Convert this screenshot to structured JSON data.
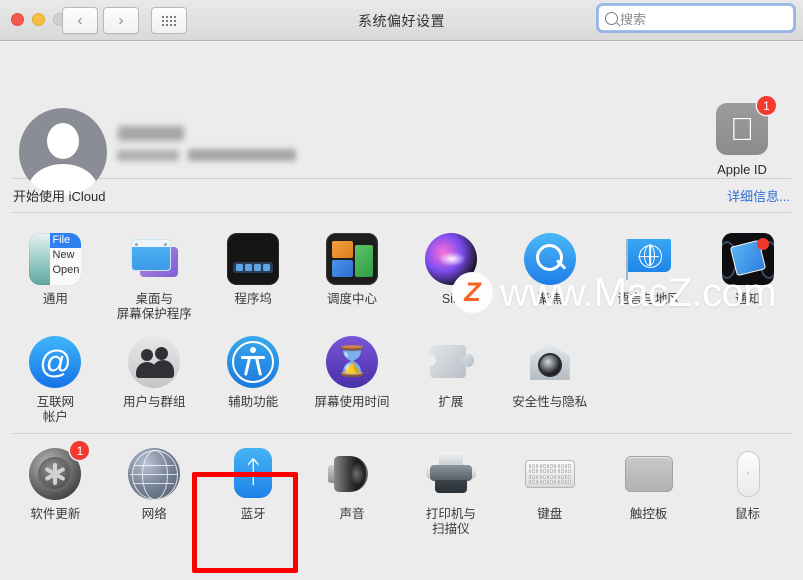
{
  "window": {
    "title": "系统偏好设置",
    "traffic_lights": [
      "close",
      "minimize",
      "zoom-disabled"
    ],
    "nav": {
      "back": "‹",
      "forward": "›",
      "grid": "grid-icon"
    },
    "search": {
      "placeholder": "搜索",
      "value": "",
      "focused": true
    }
  },
  "account": {
    "name_redacted": true,
    "detail_redacted": true,
    "apple_id": {
      "label": "Apple ID",
      "badge": "1",
      "glyph": ""
    }
  },
  "icloud": {
    "text": "开始使用 iCloud",
    "link": "详细信息..."
  },
  "watermark": {
    "logo_letter": "Z",
    "text": "www.MacZ.com"
  },
  "colors": {
    "badge_red": "#f4392f",
    "highlight_red": "#fe0000",
    "link_blue": "#2e6fd4",
    "focus_blue": "#6d9ee8",
    "bluetooth_blue": "#1d82e8",
    "watermark_orange": "#f26522"
  },
  "highlight": {
    "target": "蓝牙"
  },
  "rows": [
    {
      "items": [
        {
          "label": "通用",
          "icon": "general-icon",
          "badge": null
        },
        {
          "label": "桌面与\n屏幕保护程序",
          "icon": "desktop-screensaver-icon",
          "badge": null
        },
        {
          "label": "程序坞",
          "icon": "dock-icon",
          "badge": null
        },
        {
          "label": "调度中心",
          "icon": "mission-control-icon",
          "badge": null
        },
        {
          "label": "Siri",
          "icon": "siri-icon",
          "badge": null
        },
        {
          "label": "聚焦",
          "icon": "spotlight-icon",
          "badge": null
        },
        {
          "label": "语言与地区",
          "icon": "language-region-icon",
          "badge": null
        },
        {
          "label": "通知",
          "icon": "notifications-icon",
          "badge": null
        }
      ]
    },
    {
      "items": [
        {
          "label": "互联网\n帐户",
          "icon": "internet-accounts-icon",
          "badge": null
        },
        {
          "label": "用户与群组",
          "icon": "users-groups-icon",
          "badge": null
        },
        {
          "label": "辅助功能",
          "icon": "accessibility-icon",
          "badge": null
        },
        {
          "label": "屏幕使用时间",
          "icon": "screen-time-icon",
          "badge": null
        },
        {
          "label": "扩展",
          "icon": "extensions-icon",
          "badge": null
        },
        {
          "label": "安全性与隐私",
          "icon": "security-privacy-icon",
          "badge": null
        }
      ]
    },
    {
      "items": [
        {
          "label": "软件更新",
          "icon": "software-update-icon",
          "badge": "1"
        },
        {
          "label": "网络",
          "icon": "network-icon",
          "badge": null
        },
        {
          "label": "蓝牙",
          "icon": "bluetooth-icon",
          "badge": null
        },
        {
          "label": "声音",
          "icon": "sound-icon",
          "badge": null
        },
        {
          "label": "打印机与\n扫描仪",
          "icon": "printers-scanners-icon",
          "badge": null
        },
        {
          "label": "键盘",
          "icon": "keyboard-icon",
          "badge": null
        },
        {
          "label": "触控板",
          "icon": "trackpad-icon",
          "badge": null
        },
        {
          "label": "鼠标",
          "icon": "mouse-icon",
          "badge": null
        }
      ]
    }
  ]
}
